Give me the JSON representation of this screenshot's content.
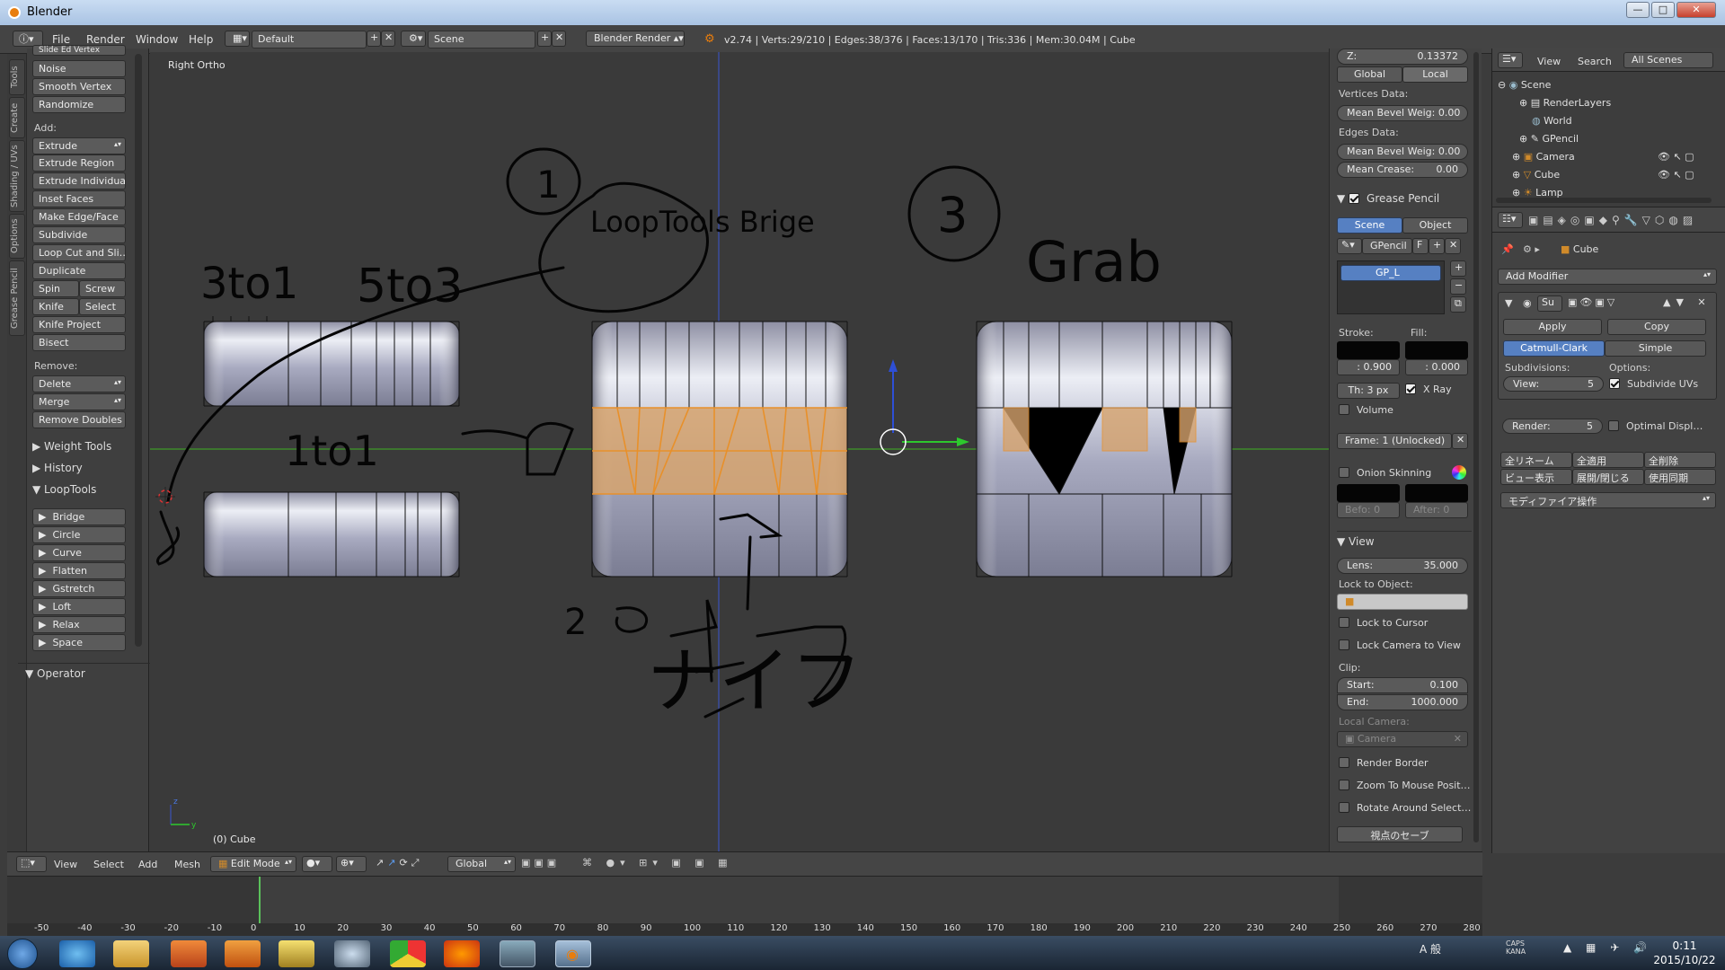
{
  "window": {
    "title": "Blender",
    "minimize": "—",
    "maximize": "□",
    "close": "✕"
  },
  "menubar": {
    "menus": [
      "File",
      "Render",
      "Window",
      "Help"
    ],
    "screen_layout": "Default",
    "scene": "Scene",
    "render_engine": "Blender Render",
    "stats": "v2.74 | Verts:29/210 | Edges:38/376 | Faces:13/170 | Tris:336 | Mem:30.04M | Cube"
  },
  "left_tabs": [
    "Tools",
    "Create",
    "Shading / UVs",
    "Options",
    "Grease Pencil"
  ],
  "toolshelf": {
    "top_items": [
      "Slide Ed  Vertex",
      "Noise",
      "Smooth Vertex",
      "Randomize"
    ],
    "add_label": "Add:",
    "add_items": [
      "Extrude",
      "Extrude Region",
      "Extrude Individual",
      "Inset Faces",
      "Make Edge/Face",
      "Subdivide",
      "Loop Cut and Sli…",
      "Duplicate"
    ],
    "spin": "Spin",
    "screw": "Screw",
    "knife": "Knife",
    "select": "Select",
    "knife_project": "Knife Project",
    "bisect": "Bisect",
    "remove_label": "Remove:",
    "delete": "Delete",
    "merge": "Merge",
    "remove_doubles": "Remove Doubles",
    "weight_tools": "Weight Tools",
    "history": "History",
    "looptools": "LoopTools",
    "looptools_items": [
      "Bridge",
      "Circle",
      "Curve",
      "Flatten",
      "Gstretch",
      "Loft",
      "Relax",
      "Space"
    ],
    "operator": "Operator"
  },
  "viewport": {
    "view_name": "Right Ortho",
    "object_label": "(0) Cube",
    "axis_z": "z",
    "axis_y": "y",
    "annotations": {
      "circle1": "1",
      "looptools_bridge": "LoopTools Brige",
      "circle3": "3",
      "grab": "Grab",
      "three_to_one": "3to1",
      "five_to_three": "5to3",
      "one_to_one": "1to1",
      "circle2": "2",
      "knife_jp": "ナイフ"
    }
  },
  "npanel": {
    "z_label": "Z:",
    "z_value": "0.13372",
    "global": "Global",
    "local": "Local",
    "vertices_data": "Vertices Data:",
    "mean_bevel_weight_v": "Mean Bevel Weig: 0.00",
    "edges_data": "Edges Data:",
    "mean_bevel_weight_e": "Mean Bevel Weig: 0.00",
    "mean_crease": "Mean Crease:",
    "mean_crease_value": "0.00",
    "grease_pencil": "Grease Pencil",
    "gp_scene": "Scene",
    "gp_object": "Object",
    "gpencil": "GPencil",
    "gp_f": "F",
    "gp_layer": "GP_L",
    "stroke": "Stroke:",
    "fill": "Fill:",
    "stroke_value": ": 0.900",
    "fill_value": ": 0.000",
    "thickness": "Th: 3 px",
    "xray": "X Ray",
    "volume": "Volume",
    "frame": "Frame: 1 (Unlocked)",
    "onion": "Onion Skinning",
    "before": "Befo: 0",
    "after": "After: 0",
    "view_header": "View",
    "lens": "Lens:",
    "lens_value": "35.000",
    "lock_to_object": "Lock to Object:",
    "lock_to_cursor": "Lock to Cursor",
    "lock_camera": "Lock Camera to View",
    "clip": "Clip:",
    "clip_start": "Start:",
    "clip_start_value": "0.100",
    "clip_end": "End:",
    "clip_end_value": "1000.000",
    "local_camera": "Local Camera:",
    "camera": "Camera",
    "render_border": "Render Border",
    "zoom_mouse": "Zoom To Mouse Posit…",
    "rotate_selection": "Rotate Around Select…",
    "save_view": "視点のセーブ"
  },
  "outliner": {
    "view": "View",
    "search": "Search",
    "filter": "All Scenes",
    "items": [
      "Scene",
      "RenderLayers",
      "World",
      "GPencil",
      "Camera",
      "Cube",
      "Lamp"
    ]
  },
  "properties": {
    "object_name": "Cube",
    "add_modifier": "Add Modifier",
    "modifier_short": "Su",
    "apply": "Apply",
    "copy": "Copy",
    "catmull": "Catmull-Clark",
    "simple": "Simple",
    "subdivisions": "Subdivisions:",
    "options": "Options:",
    "view_label": "View:",
    "view_value": "5",
    "render_label": "Render:",
    "render_value": "5",
    "subdivide_uvs": "Subdivide UVs",
    "optimal_display": "Optimal Displ…",
    "jp_rename": "全リネーム",
    "jp_apply_all": "全適用",
    "jp_delete_all": "全削除",
    "jp_view_display": "ビュー表示",
    "jp_expand": "展開/閉じる",
    "jp_sync": "使用同期",
    "jp_modifier_ops": "モディファイア操作"
  },
  "viewport_header": {
    "view": "View",
    "select": "Select",
    "add": "Add",
    "mesh": "Mesh",
    "mode": "Edit Mode",
    "orientation": "Global"
  },
  "timeline": {
    "ticks": [
      "-50",
      "-40",
      "-30",
      "-20",
      "-10",
      "0",
      "10",
      "20",
      "30",
      "40",
      "50",
      "60",
      "70",
      "80",
      "90",
      "100",
      "110",
      "120",
      "130",
      "140",
      "150",
      "160",
      "170",
      "180",
      "190",
      "200",
      "210",
      "220",
      "230",
      "240",
      "250",
      "260",
      "270",
      "280"
    ]
  },
  "taskbar": {
    "time": "0:11",
    "date": "2015/10/22",
    "tray": "A 般",
    "caps": "CAPS KANA"
  }
}
